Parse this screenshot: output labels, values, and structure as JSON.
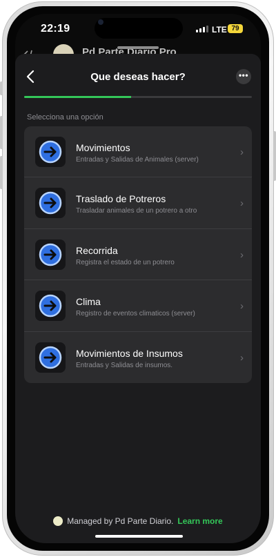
{
  "status": {
    "time": "22:19",
    "network": "LTE",
    "battery": "79"
  },
  "background_app": {
    "title": "Pd Parte Diario Pro"
  },
  "sheet": {
    "title": "Que deseas hacer?",
    "more_label": "•••",
    "progress_fraction": 0.47,
    "section_label": "Selecciona una opción",
    "options": [
      {
        "title": "Movimientos",
        "subtitle": "Entradas y Salidas de Animales (server)",
        "icon": "arrow-right-circle-icon"
      },
      {
        "title": "Traslado de Potreros",
        "subtitle": "Trasladar animales de un potrero a otro",
        "icon": "arrow-right-circle-icon"
      },
      {
        "title": "Recorrida",
        "subtitle": "Registra el estado de un potrero",
        "icon": "arrow-right-circle-icon"
      },
      {
        "title": "Clima",
        "subtitle": "Registro de eventos climaticos (server)",
        "icon": "arrow-right-circle-icon"
      },
      {
        "title": "Movimientos de Insumos",
        "subtitle": "Entradas y Salidas de insumos.",
        "icon": "arrow-right-circle-icon"
      }
    ],
    "chevron": "›"
  },
  "footer": {
    "managed_text": "Managed by Pd Parte Diario.",
    "link_text": "Learn more"
  },
  "colors": {
    "accent_green": "#34c759",
    "icon_blue": "#2f6fe0",
    "icon_ring": "#b8d4ff",
    "battery_yellow": "#f4d63a"
  }
}
